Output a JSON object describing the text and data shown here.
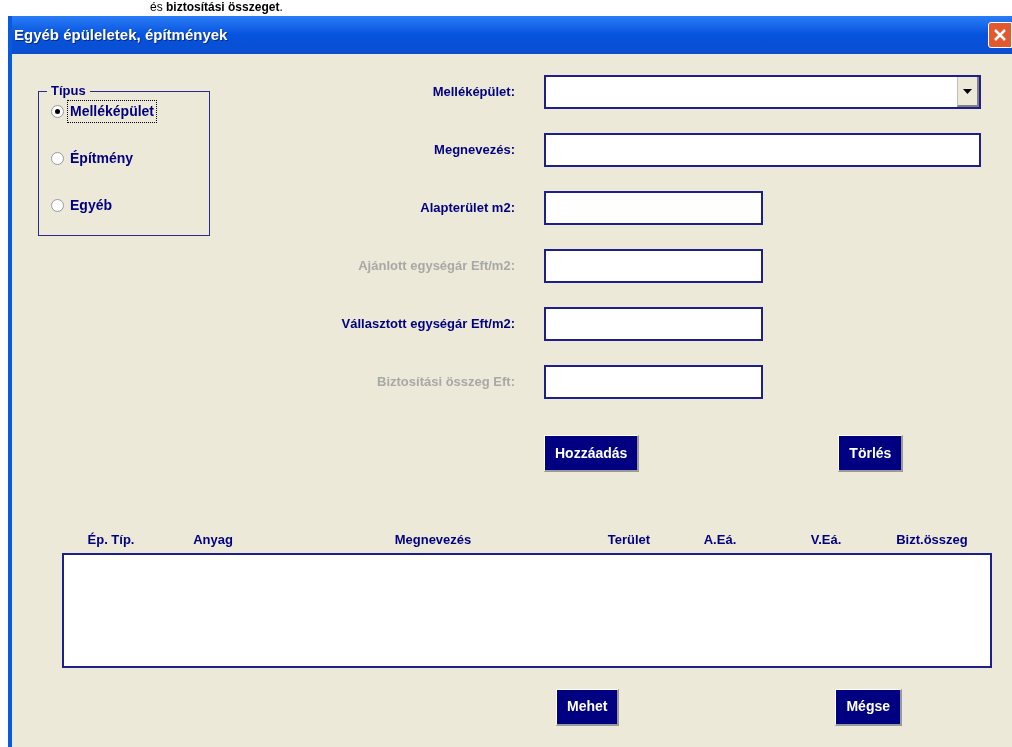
{
  "caption": "és **biztosítási összeget**.",
  "window": {
    "title": "Egyéb épüleletek, építmények"
  },
  "type_group": {
    "legend": "Típus",
    "options": [
      {
        "label": "Melléképület",
        "selected": true
      },
      {
        "label": "Építmény",
        "selected": false
      },
      {
        "label": "Egyéb",
        "selected": false
      }
    ]
  },
  "fields": [
    {
      "label": "Melléképület:",
      "kind": "dropdown",
      "disabled": false
    },
    {
      "label": "Megnevezés:",
      "kind": "text",
      "disabled": false
    },
    {
      "label": "Alapterület m2:",
      "kind": "short",
      "disabled": false
    },
    {
      "label": "Ajánlott egységár Eft/m2:",
      "kind": "short",
      "disabled": true
    },
    {
      "label": "Vállasztott egységár Eft/m2:",
      "kind": "short",
      "disabled": false
    },
    {
      "label": "Biztosítási összeg Eft:",
      "kind": "short",
      "disabled": true
    }
  ],
  "action_buttons": [
    "Hozzáadás",
    "Törlés"
  ],
  "list": {
    "columns": [
      "Ép. Típ.",
      "Anyag",
      "Megnevezés",
      "Terület",
      "A.Eá.",
      "V.Eá.",
      "Bizt.összeg"
    ]
  },
  "footer_buttons": [
    "Mehet",
    "Mégse"
  ]
}
